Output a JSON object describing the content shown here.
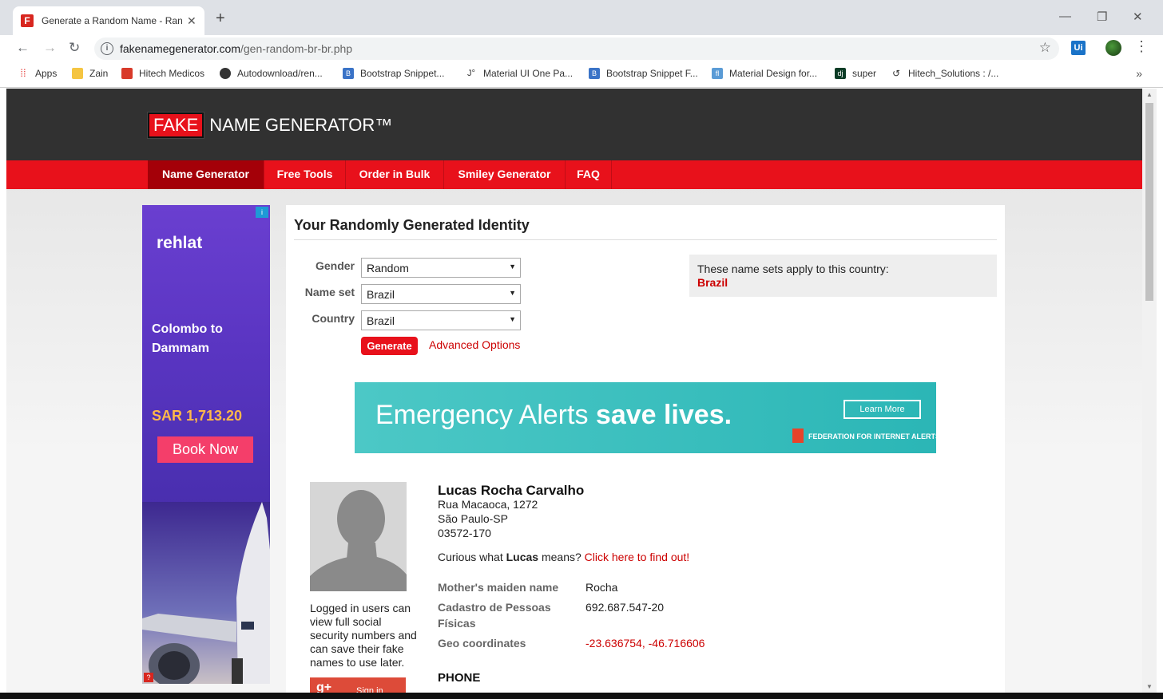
{
  "browser": {
    "tab_title": "Generate a Random Name - Random",
    "favicon_letter": "F",
    "url_domain": "fakenamegenerator.com",
    "url_path": "/gen-random-br-br.php",
    "ext_label": "Ui",
    "bookmarks": [
      {
        "label": "Apps",
        "icon": "apps-grid-icon"
      },
      {
        "label": "Zain",
        "icon": "folder-icon"
      },
      {
        "label": "Hitech Medicos",
        "icon": "medicos-icon"
      },
      {
        "label": "Autodownload/ren...",
        "icon": "github-icon"
      },
      {
        "label": "Bootstrap Snippet...",
        "icon": "bootstrap-icon"
      },
      {
        "label": "Material UI One Pa...",
        "icon": "material-ui-icon"
      },
      {
        "label": "Bootstrap Snippet F...",
        "icon": "bootstrap-icon"
      },
      {
        "label": "Material Design for...",
        "icon": "fl-icon"
      },
      {
        "label": "super",
        "icon": "django-icon"
      },
      {
        "label": "Hitech_Solutions : /...",
        "icon": "hitech-icon"
      }
    ]
  },
  "site": {
    "logo_fake": "FAKE",
    "logo_rest": "NAME GENERATOR™",
    "nav": [
      "Name Generator",
      "Free Tools",
      "Order in Bulk",
      "Smiley Generator",
      "FAQ"
    ],
    "active_nav": "Name Generator"
  },
  "side_ad": {
    "brand": "rehlat",
    "route_line1": "Colombo to",
    "route_line2": "Dammam",
    "price": "SAR 1,713.20",
    "button": "Book Now"
  },
  "form": {
    "title": "Your Randomly Generated Identity",
    "gender_label": "Gender",
    "gender_value": "Random",
    "nameset_label": "Name set",
    "nameset_value": "Brazil",
    "country_label": "Country",
    "country_value": "Brazil",
    "generate_button": "Generate",
    "advanced_link": "Advanced Options",
    "note_text": "These name sets apply to this country:",
    "note_country": "Brazil"
  },
  "banner_ad": {
    "text_light": "Emergency Alerts",
    "text_bold": "save lives.",
    "button": "Learn More",
    "org": "FEDERATION FOR INTERNET ALERTS"
  },
  "identity": {
    "name": "Lucas Rocha Carvalho",
    "address_line1": "Rua Macaoca, 1272",
    "address_line2": "São Paulo-SP",
    "address_line3": "03572-170",
    "curious_prefix": "Curious what",
    "curious_name": "Lucas",
    "curious_suffix": "means?",
    "curious_link": "Click here to find out!",
    "fields": [
      {
        "label": "Mother's maiden name",
        "value": "Rocha"
      },
      {
        "label": "Cadastro de Pessoas Físicas",
        "value": "692.687.547-20"
      },
      {
        "label": "Geo coordinates",
        "value": "-23.636754, -46.716606"
      }
    ],
    "phone_heading": "PHONE",
    "login_note": "Logged in users can view full social security numbers and can save their fake names to use later.",
    "signin_label": "Sign in"
  }
}
